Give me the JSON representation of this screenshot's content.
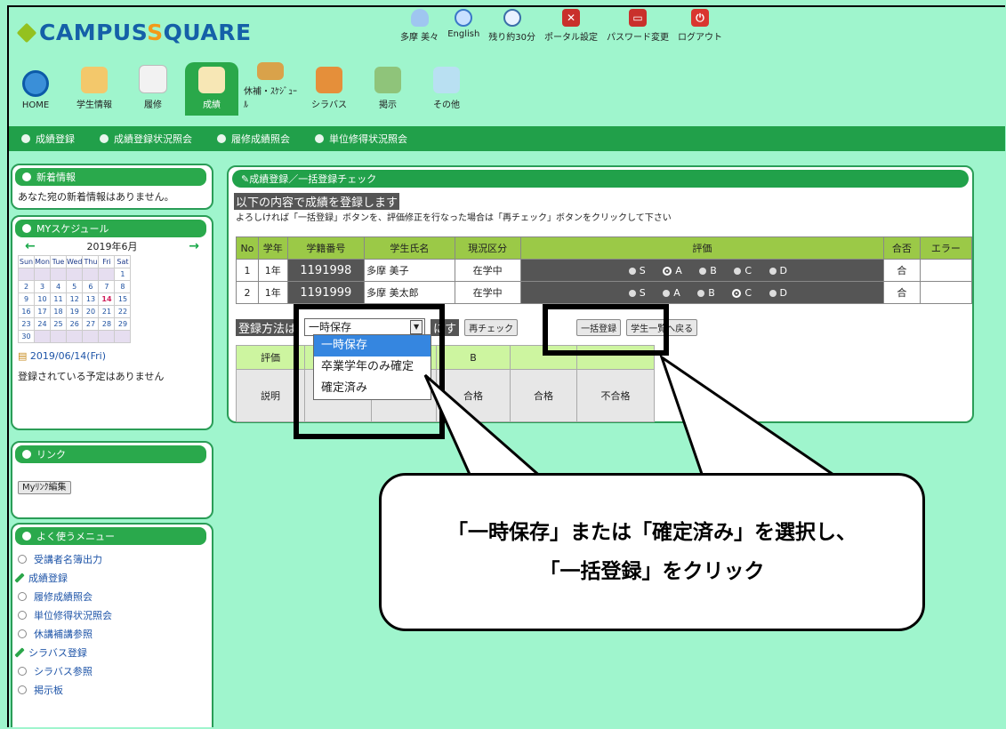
{
  "header": {
    "logo": {
      "part1": "CAMPUS",
      "part2": "S",
      "part3": "QUARE"
    },
    "toplinks": [
      {
        "label": "多摩 美々",
        "icon": "user-icon"
      },
      {
        "label": "English",
        "icon": "globe-icon"
      },
      {
        "label": "残り約30分",
        "icon": "clock-icon"
      },
      {
        "label": "ポータル設定",
        "icon": "tool-icon"
      },
      {
        "label": "パスワード変更",
        "icon": "lock-icon"
      },
      {
        "label": "ログアウト",
        "icon": "power-icon"
      }
    ],
    "nav": [
      {
        "label": "HOME",
        "icon": "home-icon"
      },
      {
        "label": "学生情報",
        "icon": "student-icon"
      },
      {
        "label": "履修",
        "icon": "course-icon"
      },
      {
        "label": "成績",
        "icon": "grade-icon",
        "active": true
      },
      {
        "label": "休補・ｽｹｼﾞｭｰﾙ",
        "icon": "schedule-icon"
      },
      {
        "label": "シラバス",
        "icon": "syllabus-icon"
      },
      {
        "label": "掲示",
        "icon": "board-icon"
      },
      {
        "label": "その他",
        "icon": "other-icon"
      }
    ],
    "subnav": [
      "成績登録",
      "成績登録状況照会",
      "履修成績照会",
      "単位修得状況照会"
    ]
  },
  "news": {
    "title": "新着情報",
    "text": "あなた宛の新着情報はありません。"
  },
  "schedule": {
    "title": "MYスケジュール",
    "month": "2019年6月",
    "days": [
      "Sun",
      "Mon",
      "Tue",
      "Wed",
      "Thu",
      "Fri",
      "Sat"
    ],
    "weeks": [
      [
        "",
        "",
        "",
        "",
        "",
        "",
        "1"
      ],
      [
        "2",
        "3",
        "4",
        "5",
        "6",
        "7",
        "8"
      ],
      [
        "9",
        "10",
        "11",
        "12",
        "13",
        "14",
        "15"
      ],
      [
        "16",
        "17",
        "18",
        "19",
        "20",
        "21",
        "22"
      ],
      [
        "23",
        "24",
        "25",
        "26",
        "27",
        "28",
        "29"
      ],
      [
        "30",
        "",
        "",
        "",
        "",
        "",
        ""
      ]
    ],
    "date": "2019/06/14(Fri)",
    "none": "登録されている予定はありません"
  },
  "links": {
    "title": "リンク",
    "edit": "Myﾘﾝｸ編集"
  },
  "favmenu": {
    "title": "よく使うメニュー",
    "items": [
      "受講者名簿出力",
      "成績登録",
      "履修成績照会",
      "単位修得状況照会",
      "休講補講参照",
      "シラバス登録",
      "シラバス参照",
      "掲示板"
    ]
  },
  "main": {
    "title": "成績登録／一括登録チェック",
    "notice": "以下の内容で成績を登録します",
    "instruction": "よろしければ「一括登録」ボタンを、評価修正を行なった場合は「再チェック」ボタンをクリックして下さい",
    "columns": [
      "No",
      "学年",
      "学籍番号",
      "学生氏名",
      "現況区分",
      "評価",
      "合否",
      "エラー"
    ],
    "rows": [
      {
        "no": "1",
        "year": "1年",
        "id": "1191998",
        "name": "多摩 美子",
        "status": "在学中",
        "grades": [
          "S",
          "A",
          "B",
          "C",
          "D"
        ],
        "selected": "A",
        "pass": "合",
        "error": ""
      },
      {
        "no": "2",
        "year": "1年",
        "id": "1191999",
        "name": "多摩 美太郎",
        "status": "在学中",
        "grades": [
          "S",
          "A",
          "B",
          "C",
          "D"
        ],
        "selected": "C",
        "pass": "合",
        "error": ""
      }
    ],
    "method_label": "登録方法は",
    "method_suffix": "にす",
    "selected_option": "一時保存",
    "options": [
      "一時保存",
      "卒業学年のみ確定",
      "確定済み"
    ],
    "btn_recheck": "再チェック",
    "btn_bulk": "一括登録",
    "btn_back": "学生一覧へ戻る",
    "legend_row1": [
      "評価",
      "",
      "",
      "B",
      "",
      ""
    ],
    "legend_row2": [
      "説明",
      "",
      "",
      "合格",
      "合格",
      "不合格"
    ]
  },
  "callout": {
    "line1": "「一時保存」または「確定済み」を選択し、",
    "line2": "「一括登録」をクリック"
  }
}
